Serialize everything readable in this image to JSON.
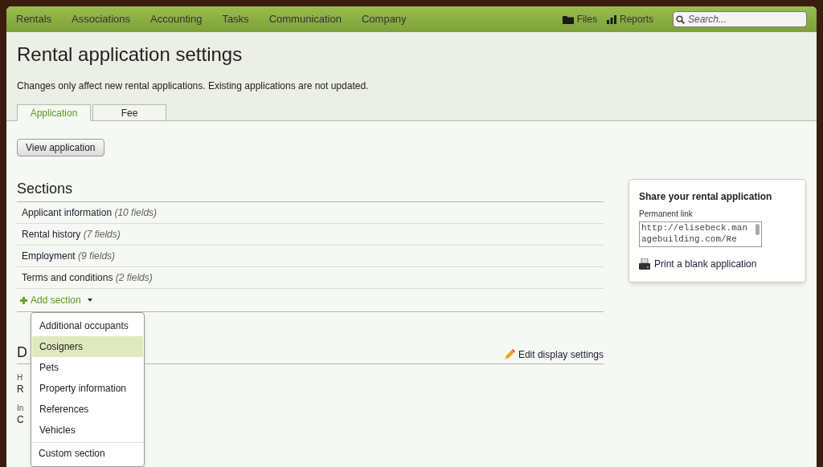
{
  "nav": {
    "items": [
      {
        "label": "Rentals"
      },
      {
        "label": "Associations"
      },
      {
        "label": "Accounting"
      },
      {
        "label": "Tasks"
      },
      {
        "label": "Communication"
      },
      {
        "label": "Company"
      }
    ],
    "tools": [
      {
        "kind": "files",
        "label": "Files"
      },
      {
        "kind": "reports",
        "label": "Reports"
      }
    ],
    "search": {
      "placeholder": "Search..."
    }
  },
  "page": {
    "title": "Rental application settings",
    "notice": "Changes only affect new rental applications. Existing applications are not updated."
  },
  "tabs": [
    {
      "label": "Application",
      "selected": true
    },
    {
      "label": "Fee",
      "selected": false
    }
  ],
  "view_button": "View application",
  "sections": {
    "heading": "Sections",
    "items": [
      {
        "name": "Applicant information",
        "count": "(10 fields)"
      },
      {
        "name": "Rental history",
        "count": "(7 fields)"
      },
      {
        "name": "Employment",
        "count": "(9 fields)"
      },
      {
        "name": "Terms and conditions",
        "count": "(2 fields)"
      }
    ],
    "add_label": "Add section"
  },
  "dropdown": {
    "items": [
      {
        "label": "Additional occupants",
        "selected": false
      },
      {
        "label": "Cosigners",
        "selected": true
      },
      {
        "label": "Pets",
        "selected": false
      },
      {
        "label": "Property information",
        "selected": false
      },
      {
        "label": "References",
        "selected": false
      },
      {
        "label": "Vehicles",
        "selected": false
      }
    ],
    "custom": "Custom section"
  },
  "display": {
    "heading": "D",
    "edit_link": "Edit display settings",
    "fragments": [
      {
        "label": "H",
        "value": "R"
      },
      {
        "label": "In",
        "value": "C"
      }
    ]
  },
  "share": {
    "title": "Share your rental application",
    "link_label": "Permanent link",
    "link": "http://elisebeck.managebuilding.com/Re",
    "print": "Print a blank application"
  }
}
